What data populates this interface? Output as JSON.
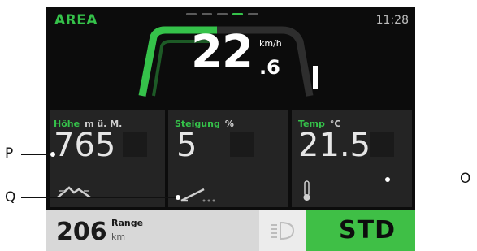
{
  "header": {
    "area_label": "AREA",
    "time": "11:28"
  },
  "speed": {
    "integer": "22",
    "decimal": ".6",
    "unit": "km/h"
  },
  "tiles": [
    {
      "label": "Höhe",
      "unit": "m ü. M.",
      "value": "765",
      "icon": "mountain-icon"
    },
    {
      "label": "Steigung",
      "unit": "%",
      "value": "5",
      "icon": "slope-icon"
    },
    {
      "label": "Temp",
      "unit": "°C",
      "value": "21.5",
      "icon": "thermometer-icon"
    }
  ],
  "bottom": {
    "range_value": "206",
    "range_label": "Range",
    "range_unit": "km",
    "mode": "STD",
    "light_icon": "headlight-icon"
  },
  "callouts": {
    "p": "P",
    "q": "Q",
    "o": "O"
  },
  "colors": {
    "accent": "#35c24a",
    "screen_bg": "#0c0c0c",
    "tile_bg": "#242424",
    "mode_bg": "#3fbf46"
  }
}
